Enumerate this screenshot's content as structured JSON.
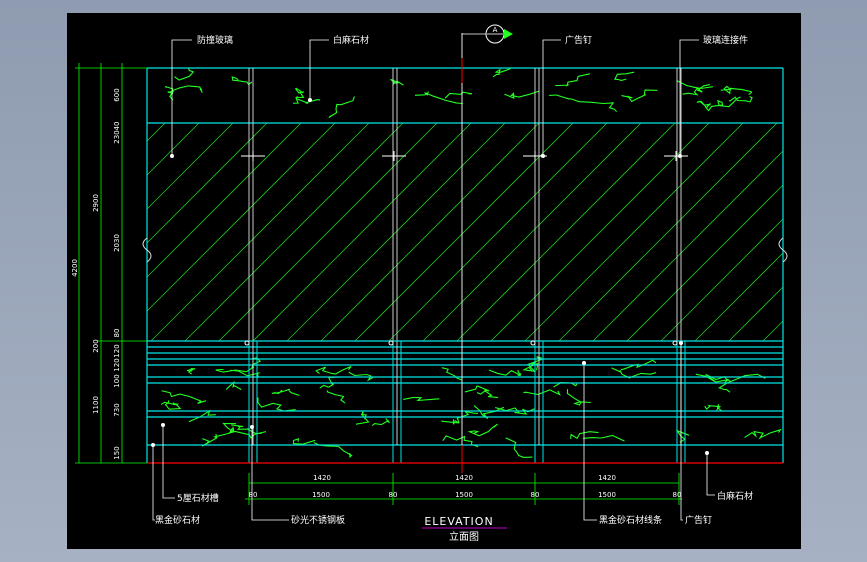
{
  "callouts_top": [
    "防撞玻璃",
    "白麻石材",
    "广告钉",
    "玻璃连接件"
  ],
  "section_marker": "A",
  "callouts_bottom_left": [
    "5厘石材槽",
    "黑金砂石材",
    "砂光不锈钢板"
  ],
  "callouts_bottom_right": [
    "白麻石材",
    "黑金砂石材线条",
    "广告钉"
  ],
  "dims_left_outer": "4200",
  "dims_left_mid": [
    "2900",
    "1100"
  ],
  "dims_left_inner": [
    "600",
    "40",
    "230",
    "2030",
    "80",
    "200",
    "120",
    "120",
    "100",
    "730",
    "150"
  ],
  "dims_bottom_top": [
    "1420",
    "1420",
    "1420"
  ],
  "dims_bottom": [
    "80",
    "1500",
    "80",
    "1500",
    "80",
    "1500",
    "80"
  ],
  "title": "ELEVATION",
  "subtitle": "立面图",
  "colors": {
    "background": "#000000",
    "line": "#00ff00",
    "structure": "#00e5e5",
    "text": "#ffffff",
    "accent": "#ff0000"
  }
}
